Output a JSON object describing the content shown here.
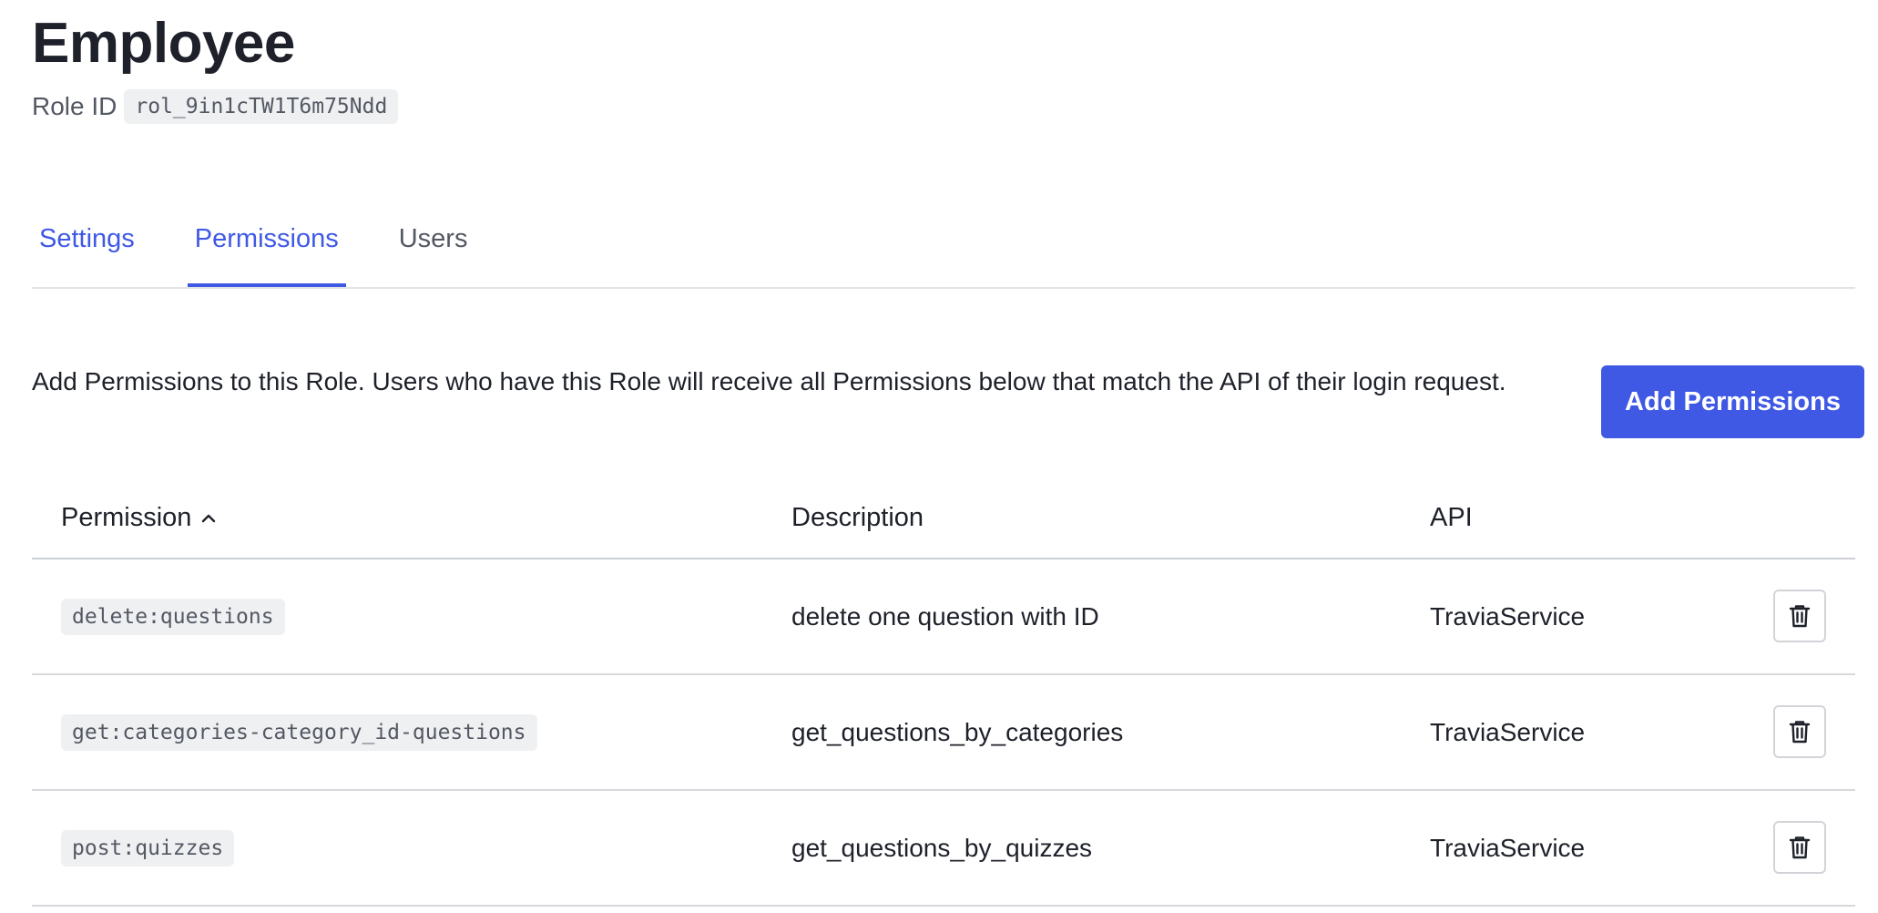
{
  "header": {
    "title": "Employee",
    "role_id_label": "Role ID",
    "role_id_value": "rol_9in1cTW1T6m75Ndd"
  },
  "tabs": [
    {
      "label": "Settings",
      "state": "link"
    },
    {
      "label": "Permissions",
      "state": "active"
    },
    {
      "label": "Users",
      "state": "inactive"
    }
  ],
  "intro": {
    "text": "Add Permissions to this Role. Users who have this Role will receive all Permissions below that match the API of their login request."
  },
  "actions": {
    "add_permissions_label": "Add Permissions"
  },
  "table": {
    "columns": {
      "permission": "Permission",
      "description": "Description",
      "api": "API"
    },
    "sort": {
      "column": "permission",
      "direction": "ascending",
      "icon": "chevron-up-icon"
    },
    "rows": [
      {
        "permission": "delete:questions",
        "description": "delete one question with ID",
        "api": "TraviaService"
      },
      {
        "permission": "get:categories-category_id-questions",
        "description": "get_questions_by_categories",
        "api": "TraviaService"
      },
      {
        "permission": "post:quizzes",
        "description": "get_questions_by_quizzes",
        "api": "TraviaService"
      }
    ],
    "row_action_icon": "trash-icon"
  },
  "colors": {
    "accent": "#3f59e4",
    "text": "#1e212a",
    "muted": "#545863",
    "chip_bg": "#eff0f2",
    "border": "#d6d8dc"
  }
}
